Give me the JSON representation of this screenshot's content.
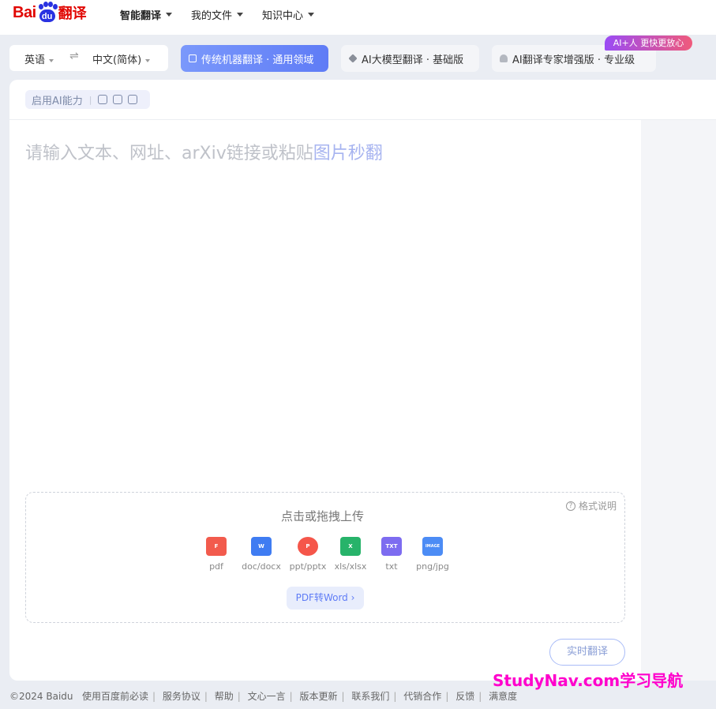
{
  "header": {
    "logo_text_latin": "Bai",
    "logo_text_paw": "du",
    "logo_text_cn": "翻译",
    "nav": [
      "智能翻译",
      "我的文件",
      "知识中心"
    ]
  },
  "lang": {
    "source": "英语",
    "swap_icon": "⇌",
    "target": "中文(简体)"
  },
  "modes": [
    {
      "label": "传统机器翻译 · 通用领域",
      "active": true
    },
    {
      "label": "AI大模型翻译 · 基础版",
      "active": false
    },
    {
      "label": "AI翻译专家增强版 · 专业级",
      "active": false
    }
  ],
  "badge": "AI+人 更快更放心",
  "ai_toggle": {
    "label": "启用AI能力",
    "sep": "|"
  },
  "editor": {
    "placeholder": "请输入文本、网址、arXiv链接或粘贴",
    "placeholder_link": "图片秒翻"
  },
  "upload": {
    "help": "格式说明",
    "title": "点击或拖拽上传",
    "types": [
      {
        "label": "pdf",
        "icon": "pdf-icon",
        "color": "#f25b4d",
        "mark": "F"
      },
      {
        "label": "doc/docx",
        "icon": "word-icon",
        "color": "#3f7cf2",
        "mark": "W"
      },
      {
        "label": "ppt/pptx",
        "icon": "ppt-icon",
        "color": "#f5564a",
        "mark": "P"
      },
      {
        "label": "xls/xlsx",
        "icon": "excel-icon",
        "color": "#27b36a",
        "mark": "X"
      },
      {
        "label": "txt",
        "icon": "txt-icon",
        "color": "#7d6cf0",
        "mark": "TXT"
      },
      {
        "label": "png/jpg",
        "icon": "image-icon",
        "color": "#4c8cf5",
        "mark": "IMAGE"
      }
    ],
    "pdf_to_word": "PDF转Word ›"
  },
  "realtime": "实时翻译",
  "footer": {
    "copyright": "©2024 Baidu",
    "links": [
      "使用百度前必读",
      "服务协议",
      "帮助",
      "文心一言",
      "版本更新",
      "联系我们",
      "代销合作",
      "反馈",
      "满意度"
    ]
  },
  "watermark": "StudyNav.com学习导航"
}
